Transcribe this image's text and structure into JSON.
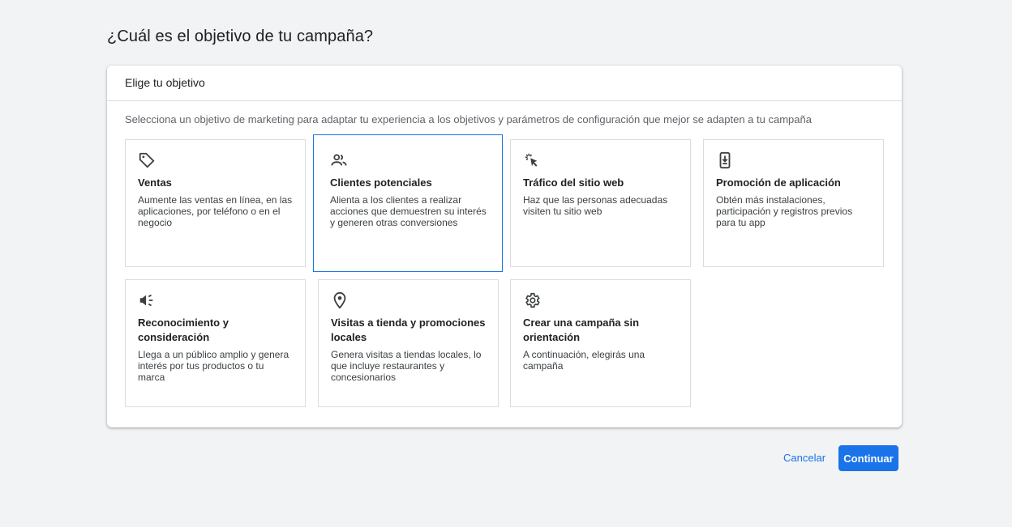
{
  "page": {
    "title": "¿Cuál es el objetivo de tu campaña?"
  },
  "panel": {
    "header": "Elige tu objetivo",
    "description": "Selecciona un objetivo de marketing para adaptar tu experiencia a los objetivos y parámetros de configuración que mejor se adapten a tu campaña"
  },
  "objectives": [
    {
      "icon": "tag-icon",
      "title": "Ventas",
      "description": "Aumente las ventas en línea, en las aplicaciones, por teléfono o en el negocio",
      "selected": false
    },
    {
      "icon": "people-icon",
      "title": "Clientes potenciales",
      "description": "Alienta a los clientes a realizar acciones que demuestren su interés y generen otras conversiones",
      "selected": true
    },
    {
      "icon": "cursor-click-icon",
      "title": "Tráfico del sitio web",
      "description": "Haz que las personas adecuadas visiten tu sitio web",
      "selected": false
    },
    {
      "icon": "phone-download-icon",
      "title": "Promoción de aplicación",
      "description": "Obtén más instalaciones, participación y registros previos para tu app",
      "selected": false
    },
    {
      "icon": "megaphone-icon",
      "title": "Reconocimiento y consideración",
      "description": "Llega a un público amplio y genera interés por tus productos o tu marca",
      "selected": false
    },
    {
      "icon": "location-pin-icon",
      "title": "Visitas a tienda y promociones locales",
      "description": "Genera visitas a tiendas locales, lo que incluye restaurantes y concesionarios",
      "selected": false
    },
    {
      "icon": "gear-icon",
      "title": "Crear una campaña sin orientación",
      "description": "A continuación, elegirás una campaña",
      "selected": false
    }
  ],
  "actions": {
    "cancel_label": "Cancelar",
    "continue_label": "Continuar"
  },
  "colors": {
    "accent": "#1a73e8",
    "background": "#f1f3f4",
    "card_border": "#dadce0"
  }
}
